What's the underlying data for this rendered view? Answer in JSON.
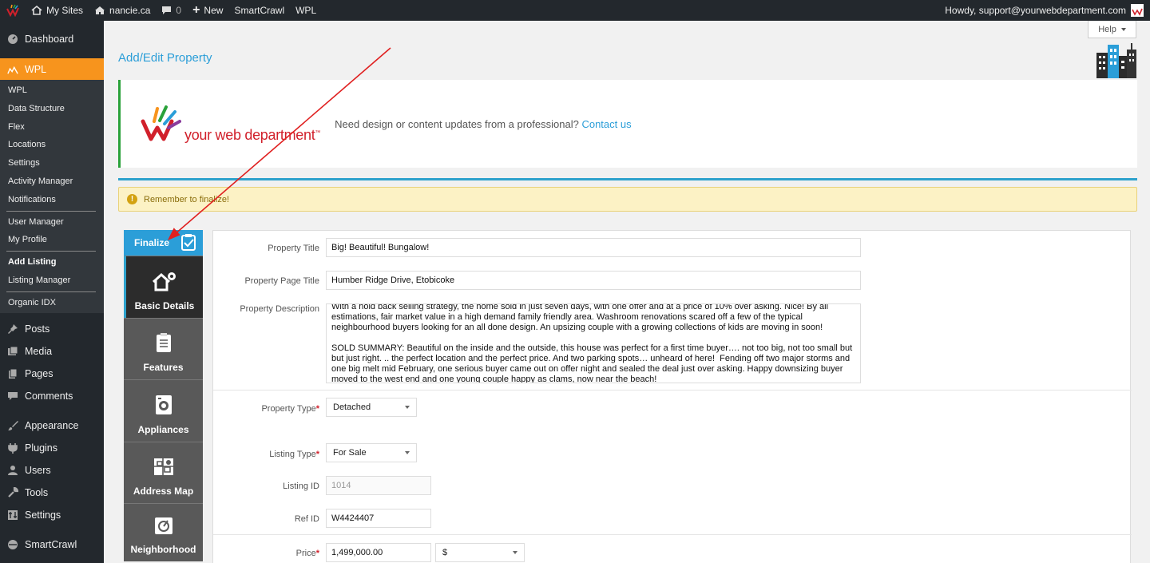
{
  "adminbar": {
    "my_sites": "My Sites",
    "site_name": "nancie.ca",
    "comments_count": "0",
    "new_label": "New",
    "smartcrawl": "SmartCrawl",
    "wpl": "WPL",
    "howdy": "Howdy, support@yourwebdepartment.com"
  },
  "sidebar": {
    "dashboard": "Dashboard",
    "wpl_header": "WPL",
    "submenu": [
      {
        "label": "WPL"
      },
      {
        "label": "Data Structure"
      },
      {
        "label": "Flex"
      },
      {
        "label": "Locations"
      },
      {
        "label": "Settings"
      },
      {
        "label": "Activity Manager"
      },
      {
        "label": "Notifications"
      },
      {
        "label": "User Manager"
      },
      {
        "label": "My Profile"
      },
      {
        "label": "Add Listing"
      },
      {
        "label": "Listing Manager"
      },
      {
        "label": "Organic IDX"
      }
    ],
    "menu": [
      {
        "label": "Posts"
      },
      {
        "label": "Media"
      },
      {
        "label": "Pages"
      },
      {
        "label": "Comments"
      },
      {
        "label": "Appearance"
      },
      {
        "label": "Plugins"
      },
      {
        "label": "Users"
      },
      {
        "label": "Tools"
      },
      {
        "label": "Settings"
      },
      {
        "label": "SmartCrawl"
      }
    ]
  },
  "page": {
    "help": "Help",
    "title": "Add/Edit Property"
  },
  "banner": {
    "brand_pre": "your ",
    "brand_web": "web",
    "brand_post": " department",
    "brand_tm": "™",
    "message": "Need design or content updates from a professional?",
    "contact": "Contact us"
  },
  "notice": {
    "text": "Remember to finalize!"
  },
  "tabs": {
    "finalize": "Finalize",
    "items": [
      {
        "label": "Basic Details"
      },
      {
        "label": "Features"
      },
      {
        "label": "Appliances"
      },
      {
        "label": "Address Map"
      },
      {
        "label": "Neighborhood"
      }
    ]
  },
  "form": {
    "property_title_label": "Property Title",
    "property_title": "Big! Beautiful! Bungalow!",
    "page_title_label": "Property Page Title",
    "page_title": "Humber Ridge Drive, Etobicoke",
    "description_label": "Property Description",
    "description": "With a hold back selling strategy, the home sold in just seven days, with one offer and at a price of 10% over asking. Nice! By all estimations, fair market value in a high demand family friendly area. Washroom renovations scared off a few of the typical neighbourhood buyers looking for an all done design. An upsizing couple with a growing collections of kids are moving in soon!\n\nSOLD SUMMARY: Beautiful on the inside and the outside, this house was perfect for a first time buyer…. not too big, not too small but but just right. .. the perfect location and the perfect price. And two parking spots… unheard of here!  Fending off two major storms and one big melt mid February, one serious buyer came out on offer night and sealed the deal just over asking. Happy downsizing buyer moved to the west end and one young couple happy as clams, now near the beach!",
    "property_type_label": "Property Type",
    "property_type": "Detached",
    "listing_type_label": "Listing Type",
    "listing_type": "For Sale",
    "listing_id_label": "Listing ID",
    "listing_id": "1014",
    "ref_id_label": "Ref ID",
    "ref_id": "W4424407",
    "price_label": "Price",
    "price": "1,499,000.00",
    "currency": "$",
    "required_mark": "*"
  },
  "colors": {
    "wpl_orange": "#f7941d",
    "accent_blue": "#2b9ed8",
    "brand_red": "#d1202b",
    "arrow_red": "#e02020"
  }
}
